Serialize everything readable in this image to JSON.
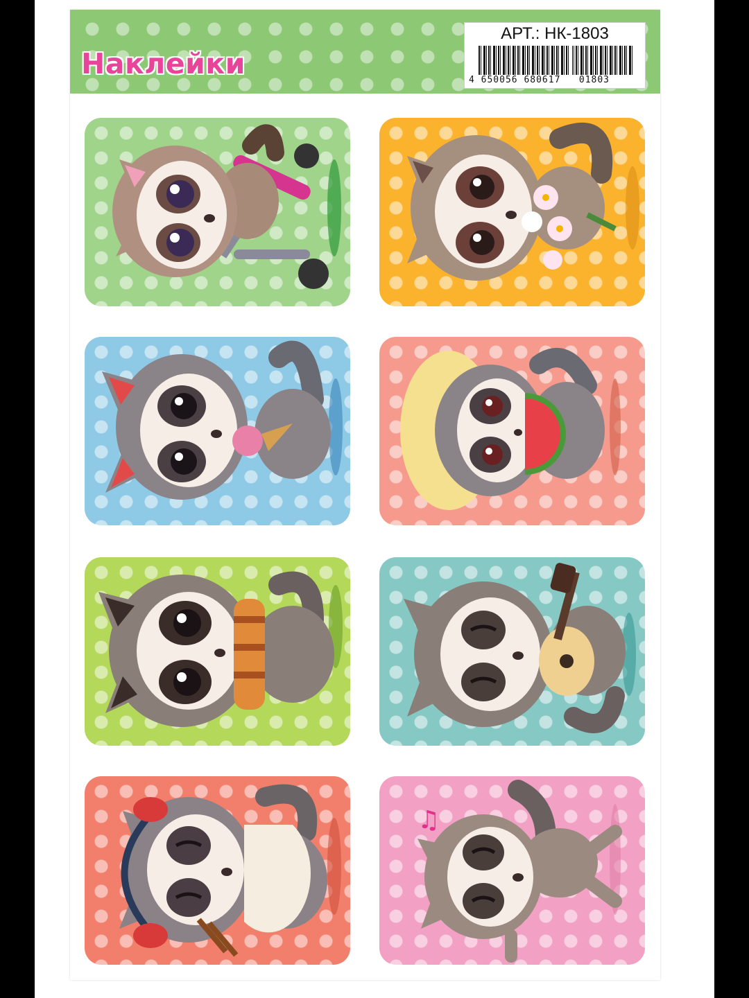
{
  "header": {
    "title": "Наклейки",
    "article": "АРТ.: НК-1803",
    "barcode_digits": "4 650056 680617   01803"
  },
  "colors": {
    "header_green": "#8dc874",
    "title_pink": "#e8459a"
  },
  "stickers": [
    {
      "subject": "raccoon-on-scooter",
      "bg": "#9fd48a"
    },
    {
      "subject": "raccoon-with-flowers",
      "bg": "#fbb32e"
    },
    {
      "subject": "raccoon-with-ice-cream",
      "bg": "#8ec9e6"
    },
    {
      "subject": "raccoon-with-watermelon",
      "bg": "#f59a8c"
    },
    {
      "subject": "raccoon-with-scarf",
      "bg": "#b4d85a"
    },
    {
      "subject": "raccoon-with-guitar",
      "bg": "#86c9c4"
    },
    {
      "subject": "raccoon-with-noodles",
      "bg": "#f27f6c"
    },
    {
      "subject": "raccoon-dancing",
      "bg": "#f2a1c4"
    }
  ]
}
